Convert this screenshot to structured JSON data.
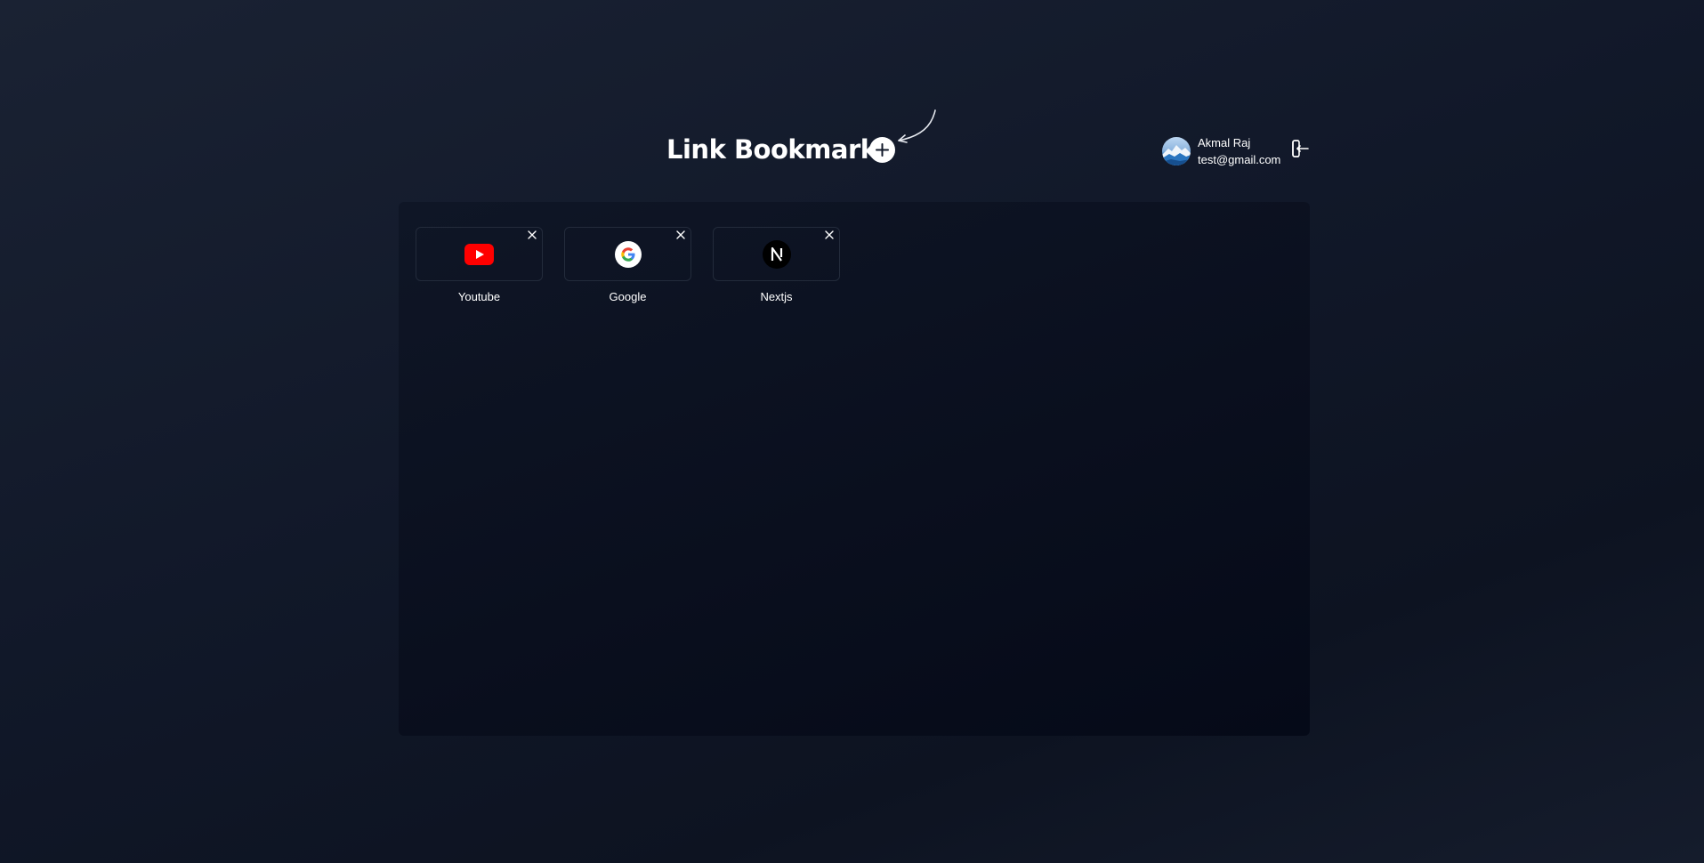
{
  "header": {
    "title": "Link Bookmark",
    "add_icon": "plus-circle-icon",
    "arrow_icon": "curved-arrow-icon"
  },
  "user": {
    "name": "Akmal Raj",
    "email": "test@gmail.com",
    "avatar_icon": "avatar-image",
    "logout_icon": "logout-icon"
  },
  "bookmarks": [
    {
      "label": "Youtube",
      "icon": "youtube-icon",
      "remove_icon": "close-icon"
    },
    {
      "label": "Google",
      "icon": "google-icon",
      "remove_icon": "close-icon"
    },
    {
      "label": "Nextjs",
      "icon": "nextjs-icon",
      "remove_icon": "close-icon"
    }
  ],
  "colors": {
    "background": "#111829",
    "panel": "#0a0f1e",
    "card_border": "#232b3b",
    "text": "#ffffff",
    "youtube_red": "#ff0000"
  }
}
